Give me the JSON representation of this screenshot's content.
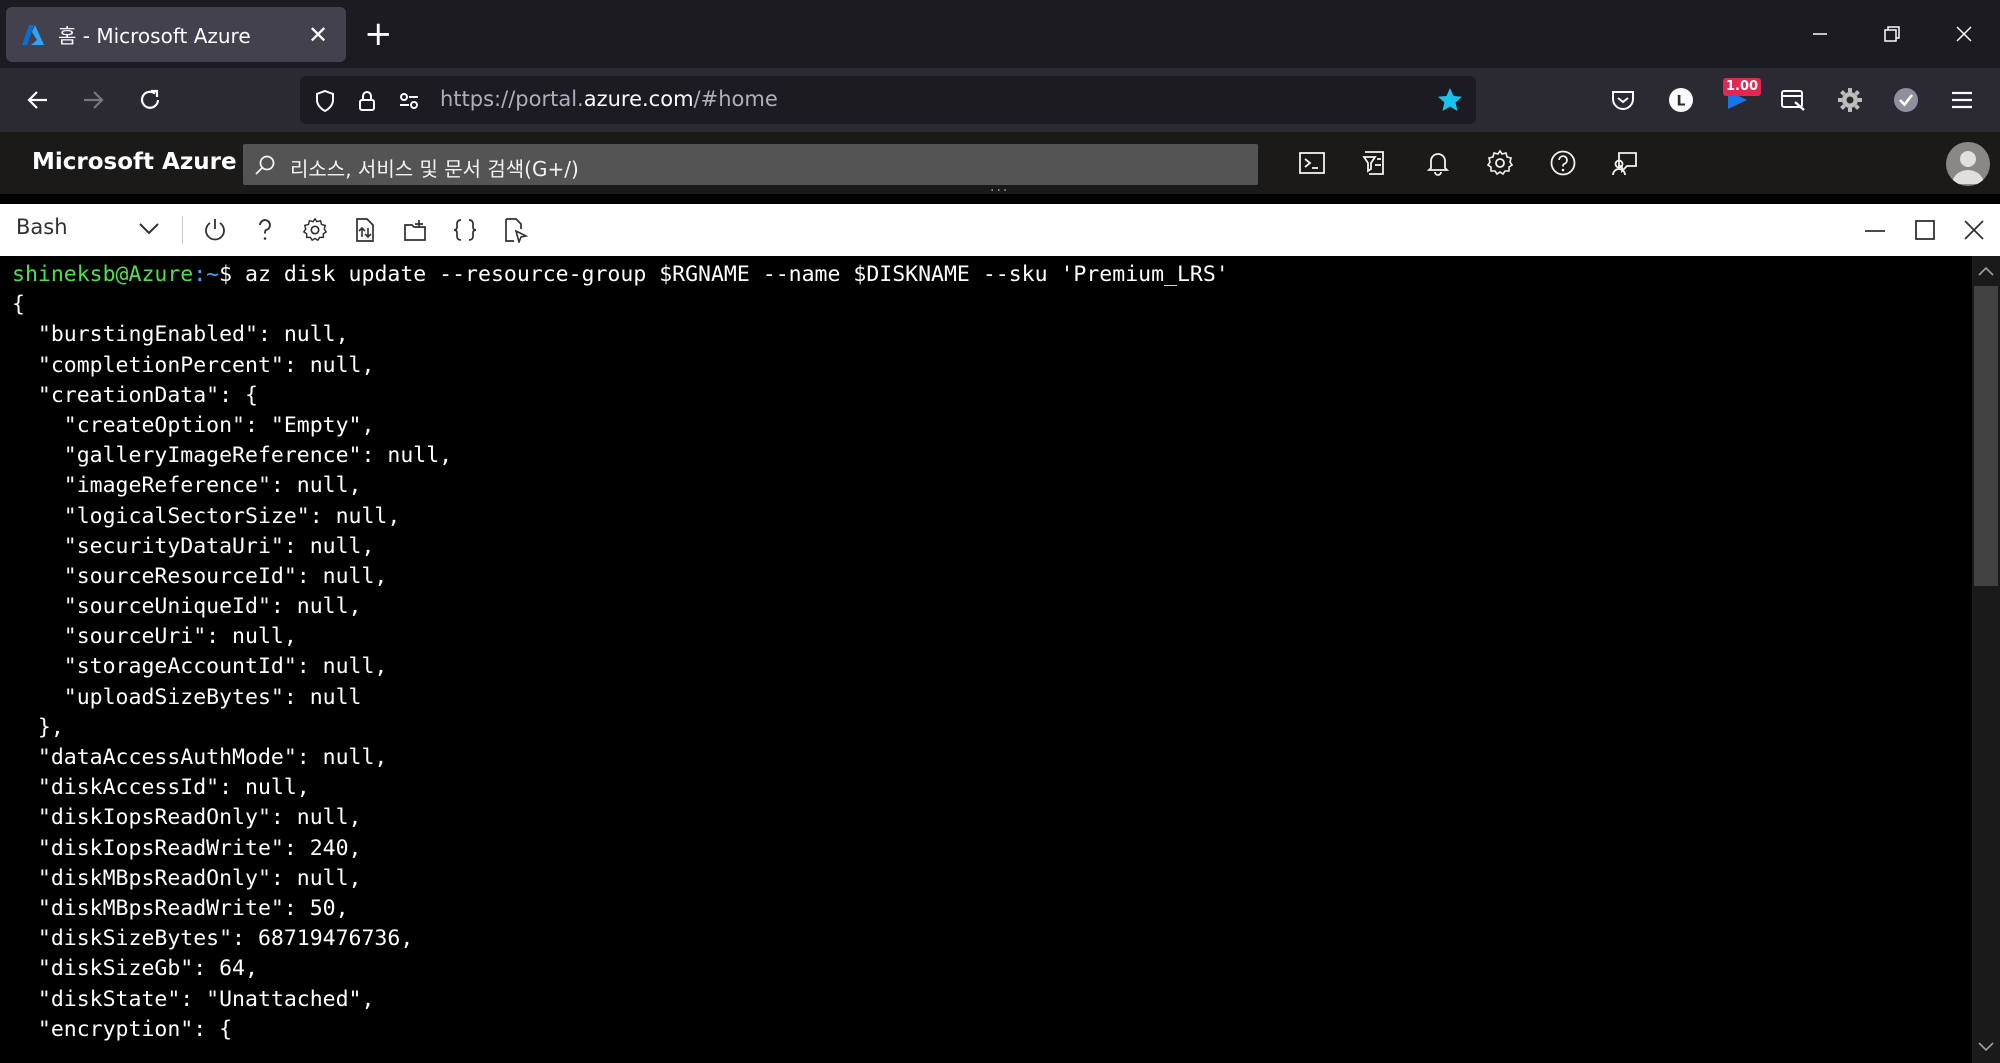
{
  "browser": {
    "tab_title": "홈 - Microsoft Azure",
    "tab_close": "✕",
    "new_tab": "+",
    "url_prefix": "https://portal.",
    "url_host": "azure.com",
    "url_suffix": "/#home",
    "extension_badge": "1.00",
    "profile_initial": "L",
    "accent": "#19c3f0"
  },
  "azure": {
    "brand": "Microsoft Azure",
    "search_placeholder": "리소스, 서비스 및 문서 검색(G+/)",
    "header_bg": "#1b1a19"
  },
  "shell": {
    "selected_shell": "Bash",
    "grip": "···"
  },
  "terminal": {
    "prompt_user": "shineksb@Azure",
    "prompt_path": ":~",
    "prompt_symbol": "$ ",
    "command": "az disk update --resource-group $RGNAME --name $DISKNAME --sku 'Premium_LRS'",
    "output": [
      "{",
      "  \"burstingEnabled\": null,",
      "  \"completionPercent\": null,",
      "  \"creationData\": {",
      "    \"createOption\": \"Empty\",",
      "    \"galleryImageReference\": null,",
      "    \"imageReference\": null,",
      "    \"logicalSectorSize\": null,",
      "    \"securityDataUri\": null,",
      "    \"sourceResourceId\": null,",
      "    \"sourceUniqueId\": null,",
      "    \"sourceUri\": null,",
      "    \"storageAccountId\": null,",
      "    \"uploadSizeBytes\": null",
      "  },",
      "  \"dataAccessAuthMode\": null,",
      "  \"diskAccessId\": null,",
      "  \"diskIopsReadOnly\": null,",
      "  \"diskIopsReadWrite\": 240,",
      "  \"diskMBpsReadOnly\": null,",
      "  \"diskMBpsReadWrite\": 50,",
      "  \"diskSizeBytes\": 68719476736,",
      "  \"diskSizeGb\": 64,",
      "  \"diskState\": \"Unattached\",",
      "  \"encryption\": {"
    ],
    "prompt_user_color": "#4ae24a",
    "prompt_path_color": "#3ea4f5"
  }
}
